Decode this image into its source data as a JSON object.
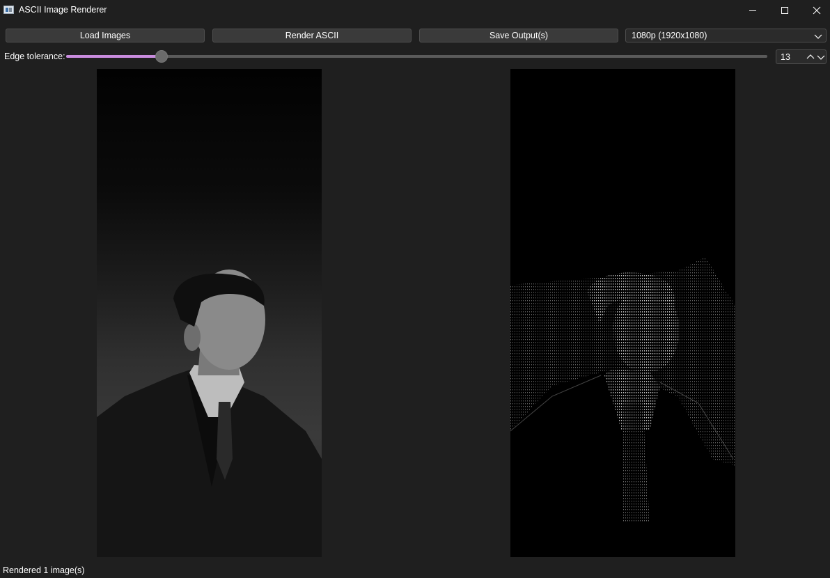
{
  "window": {
    "title": "ASCII Image Renderer",
    "controls": [
      "minimize-icon",
      "maximize-icon",
      "close-icon"
    ]
  },
  "toolbar": {
    "load_label": "Load Images",
    "render_label": "Render ASCII",
    "save_label": "Save Output(s)",
    "resolution": {
      "selected": "1080p (1920x1080)",
      "icon": "chevron-down-icon"
    }
  },
  "tolerance": {
    "label": "Edge tolerance:",
    "value": "13",
    "slider_fraction": 0.136,
    "accent_color": "#c98cde"
  },
  "preview": {
    "left_panel": "source-photo",
    "right_panel": "ascii-render"
  },
  "status": {
    "text": "Rendered 1 image(s)"
  }
}
